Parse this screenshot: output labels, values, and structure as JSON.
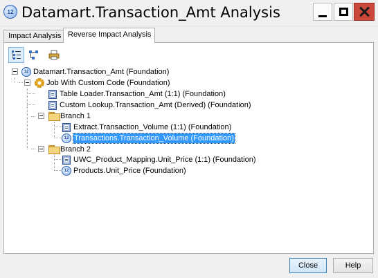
{
  "window": {
    "title": "Datamart.Transaction_Amt Analysis",
    "app_icon": "column-icon"
  },
  "tabs": [
    {
      "label": "Impact Analysis",
      "active": false
    },
    {
      "label": "Reverse Impact Analysis",
      "active": true
    }
  ],
  "toolbar": {
    "buttons": [
      {
        "icon": "tree-view-icon",
        "active": true
      },
      {
        "icon": "diagram-view-icon",
        "active": false
      },
      {
        "icon": "print-icon",
        "active": false
      }
    ]
  },
  "tree": {
    "root": "Datamart.Transaction_Amt (Foundation)",
    "job": "Job With Custom Code (Foundation)",
    "job_items": [
      "Table Loader.Transaction_Amt (1:1) (Foundation)",
      "Custom Lookup.Transaction_Amt (Derived) (Foundation)"
    ],
    "branch1": {
      "label": "Branch 1",
      "items": [
        "Extract.Transaction_Volume (1:1) (Foundation)",
        "Transactions.Transaction_Volume (Foundation)"
      ]
    },
    "branch2": {
      "label": "Branch 2",
      "items": [
        "UWC_Product_Mapping.Unit_Price (1:1) (Foundation)",
        "Products.Unit_Price (Foundation)"
      ]
    },
    "selected": "Transactions.Transaction_Volume (Foundation)"
  },
  "buttons": {
    "close": "Close",
    "help": "Help"
  },
  "colors": {
    "selection": "#3399ff",
    "close_button": "#c9473b"
  }
}
